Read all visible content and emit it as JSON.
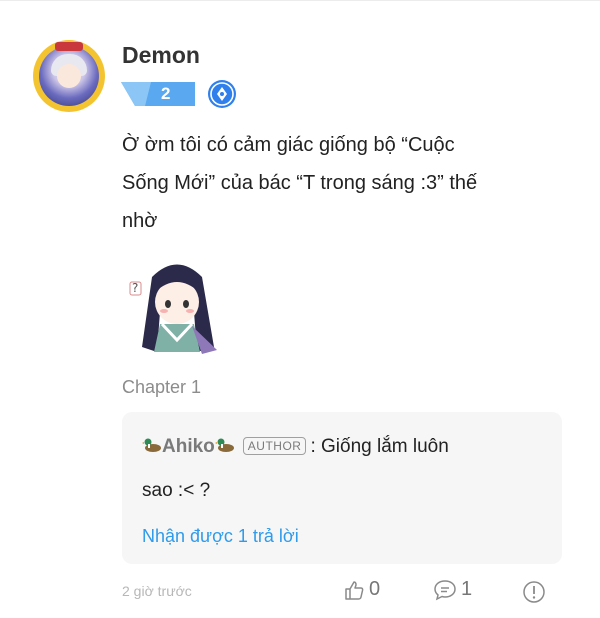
{
  "comment": {
    "username": "Demon",
    "level": "2",
    "text_lines": [
      "Ờ ờm tôi có cảm giác giống bộ “Cuộc",
      "Sống Mới” của bác “T trong sáng :3” thế",
      "nhờ"
    ],
    "chapter": "Chapter 1",
    "time": "2 giờ trước",
    "likes": "0",
    "replies": "1"
  },
  "reply": {
    "author": "Ahiko",
    "author_tag": "AUTHOR",
    "text": ": Giống lắm luôn",
    "text_cont": "sao :< ?",
    "view_replies": "Nhận được 1 trả lời"
  },
  "icons": {
    "pen": "pen-nib-icon",
    "like": "thumbs-up-icon",
    "reply": "chat-bubble-icon",
    "report": "alert-circle-icon",
    "duck": "duck-icon"
  },
  "colors": {
    "link": "#2f9bea",
    "badge": "#2f80ed"
  }
}
